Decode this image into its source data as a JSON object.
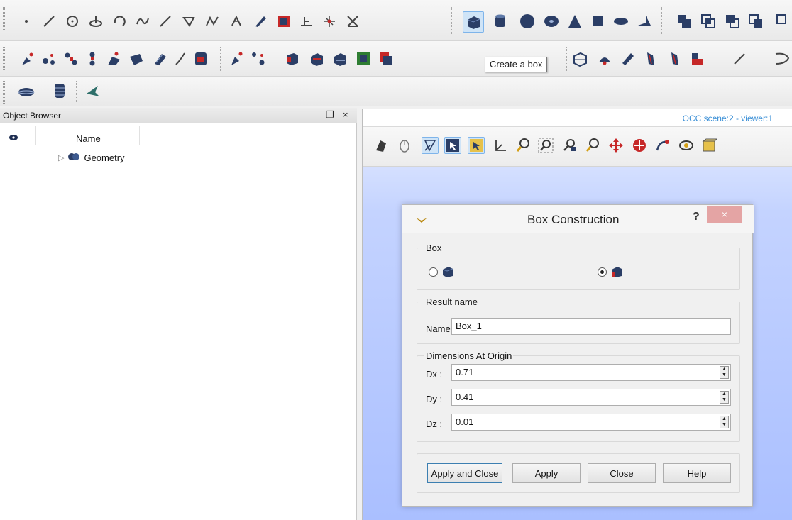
{
  "tooltip": "Create a box",
  "object_browser": {
    "title": "Object Browser",
    "float_glyph": "❐",
    "close_glyph": "×",
    "column_name": "Name",
    "tree": [
      {
        "label": "Geometry",
        "expand_glyph": "▷"
      }
    ]
  },
  "viewer": {
    "title": "OCC scene:2 - viewer:1"
  },
  "dialog": {
    "title": "Box Construction",
    "help_glyph": "?",
    "close_glyph": "×",
    "box_group": {
      "label": "Box",
      "selected_option": 2
    },
    "result_group": {
      "label": "Result name",
      "name_label": "Name",
      "name_value": "Box_1"
    },
    "dims_group": {
      "label": "Dimensions At Origin",
      "fields": [
        {
          "label": "Dx :",
          "value": "0.71"
        },
        {
          "label": "Dy :",
          "value": "0.41"
        },
        {
          "label": "Dz :",
          "value": "0.01"
        }
      ]
    },
    "buttons": {
      "apply_close": "Apply and Close",
      "apply": "Apply",
      "close": "Close",
      "help": "Help"
    }
  },
  "colors": {
    "accent": "#3a8fd6",
    "viewer_background": "#aabfff",
    "close_button": "#e4a4a4",
    "primitive_shape": "#2b3e66",
    "tool_red": "#c62828"
  }
}
